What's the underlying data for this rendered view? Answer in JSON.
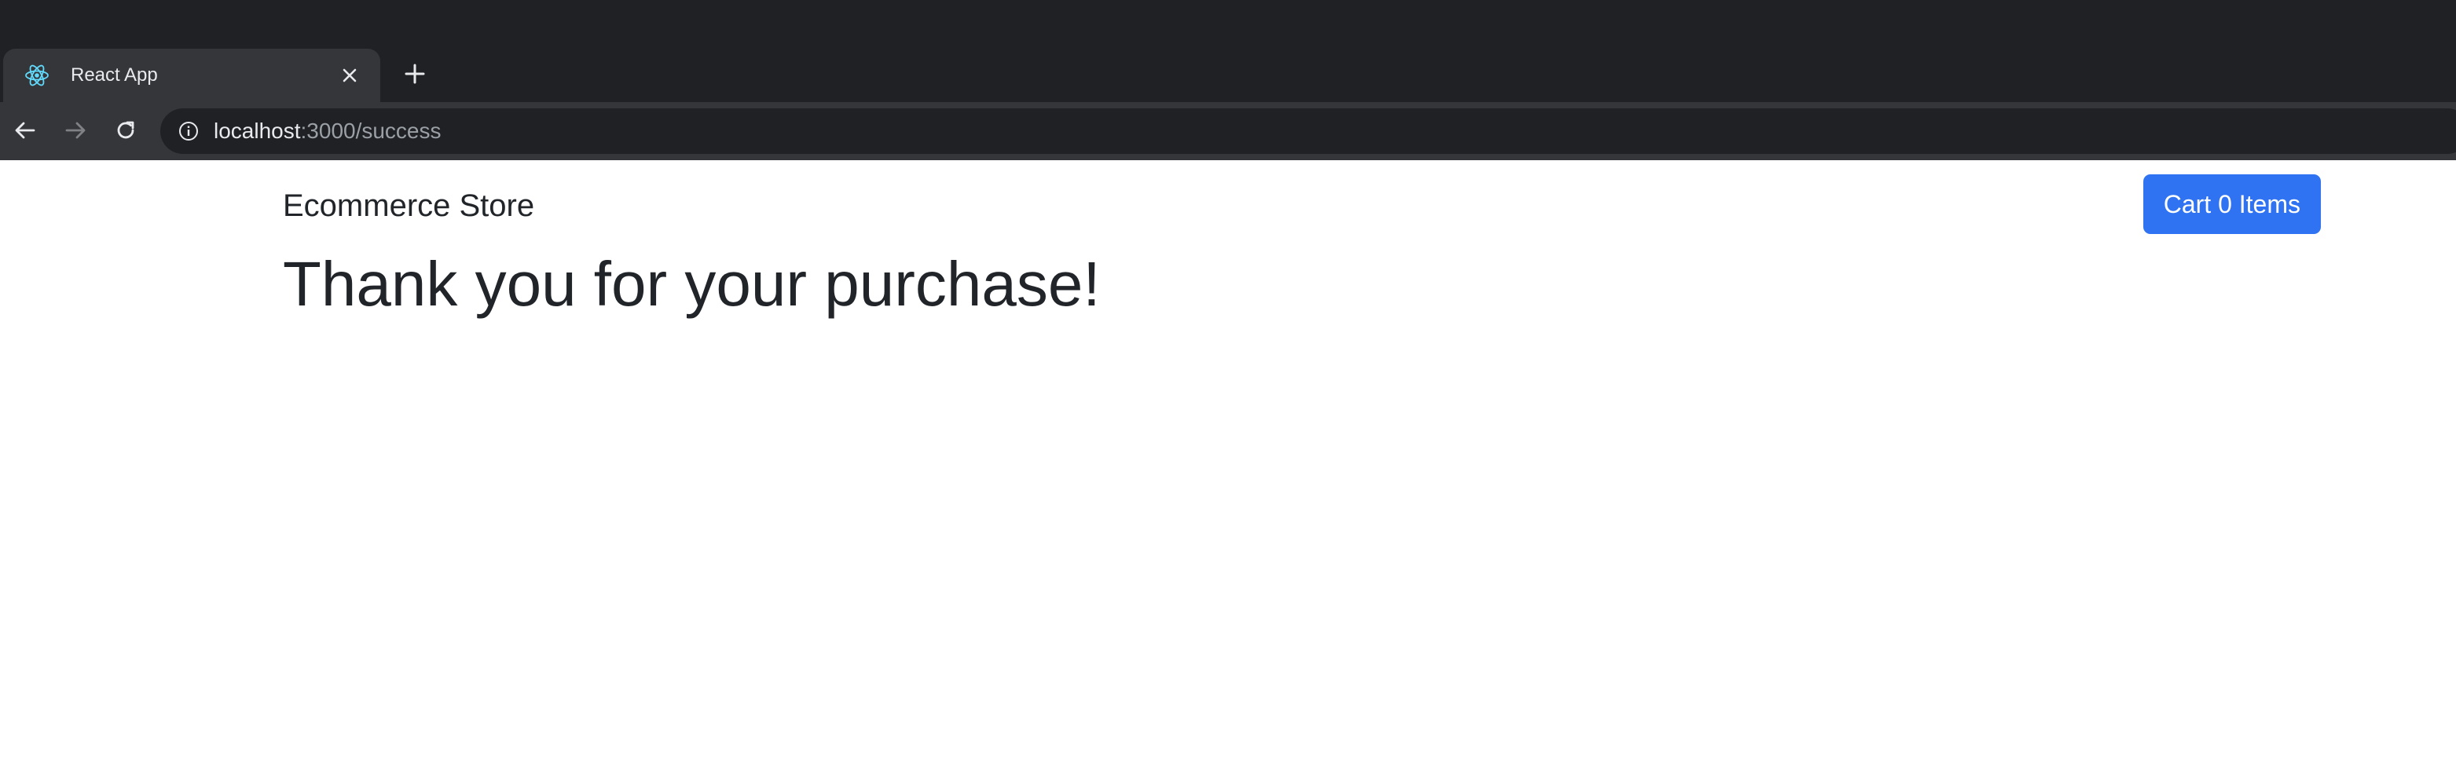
{
  "browser": {
    "tab": {
      "title": "React App",
      "favicon": "react-logo-icon"
    },
    "toolbar": {
      "url_host": "localhost",
      "url_path": ":3000/success",
      "icons": {
        "back": "back-arrow-icon",
        "forward": "forward-arrow-icon",
        "reload": "reload-icon",
        "info": "info-icon",
        "new_tab": "plus-icon",
        "close_tab": "close-icon"
      }
    }
  },
  "page": {
    "brand": "Ecommerce Store",
    "cart_button_label": "Cart 0 Items",
    "heading": "Thank you for your purchase!"
  },
  "colors": {
    "chrome_dark": "#202124",
    "chrome_tab": "#35363a",
    "cart_button": "#2f73f2",
    "text_dark": "#212529"
  }
}
